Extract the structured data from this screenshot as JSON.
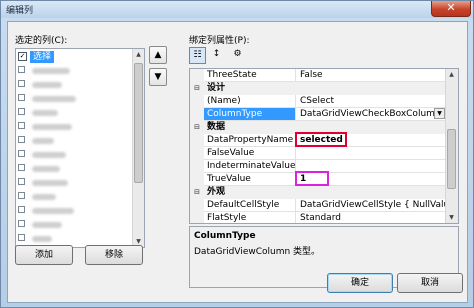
{
  "window": {
    "title": "编辑列",
    "close_label": "✕"
  },
  "left": {
    "list_label": "选定的列(C):",
    "selected_item": "选择",
    "add_button": "添加",
    "remove_button": "移除",
    "move_up": "▲",
    "move_down": "▼"
  },
  "right": {
    "props_label": "绑定列属性(P):",
    "rows": [
      {
        "name": "ThreeState",
        "value": "False"
      },
      {
        "category": "设计"
      },
      {
        "name": "(Name)",
        "value": "CSelect"
      },
      {
        "name": "ColumnType",
        "value": "DataGridViewCheckBoxColumn"
      },
      {
        "category": "数据"
      },
      {
        "name": "DataPropertyName",
        "value": "selected"
      },
      {
        "name": "FalseValue",
        "value": ""
      },
      {
        "name": "IndeterminateValue",
        "value": ""
      },
      {
        "name": "TrueValue",
        "value": "1"
      },
      {
        "category": "外观"
      },
      {
        "name": "DefaultCellStyle",
        "value": "DataGridViewCellStyle { NullValue=Fal"
      },
      {
        "name": "FlatStyle",
        "value": "Standard"
      }
    ],
    "description_title": "ColumnType",
    "description_text": "DataGridViewColumn 类型。"
  },
  "footer": {
    "ok": "确定",
    "cancel": "取消"
  },
  "colors": {
    "selection": "#3399ff",
    "highlight_red": "#e00030",
    "highlight_magenta": "#dd22dd"
  },
  "icons": [
    "checkbox-icon",
    "categorized-icon",
    "alphabetical-icon",
    "property-pages-icon",
    "move-up-icon",
    "move-down-icon",
    "collapse-icon",
    "dropdown-arrow-icon",
    "close-icon"
  ]
}
